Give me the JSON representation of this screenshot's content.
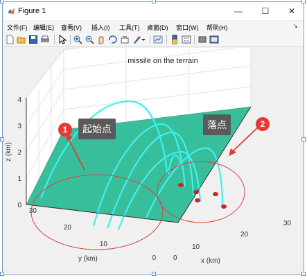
{
  "window": {
    "title": "Figure 1",
    "minimize_glyph": "—",
    "maximize_glyph": "☐",
    "close_glyph": "✕"
  },
  "menu": {
    "items": [
      {
        "label": "文件(F)"
      },
      {
        "label": "编辑(E)"
      },
      {
        "label": "查看(V)"
      },
      {
        "label": "插入(I)"
      },
      {
        "label": "工具(T)"
      },
      {
        "label": "桌面(D)"
      },
      {
        "label": "窗口(W)"
      },
      {
        "label": "帮助(H)"
      }
    ],
    "overflow_glyph": "↘"
  },
  "toolbar": {
    "icons": [
      "new-figure-icon",
      "open-file-icon",
      "save-icon",
      "print-icon",
      "pointer-icon",
      "zoom-in-icon",
      "zoom-out-icon",
      "pan-icon",
      "rotate-3d-icon",
      "data-cursor-icon",
      "brush-icon",
      "link-plot-icon",
      "colorbar-icon",
      "legend-icon",
      "hide-plot-tools-icon",
      "show-plot-tools-icon"
    ]
  },
  "plot": {
    "title": "missile on the terrain",
    "xlabel": "x (km)",
    "ylabel": "y (km)",
    "zlabel": "z (km)",
    "x_ticks": [
      "0",
      "10",
      "20",
      "30"
    ],
    "y_ticks": [
      "0",
      "10",
      "20",
      "30"
    ],
    "z_ticks": [
      "0",
      "1",
      "2",
      "3",
      "4"
    ],
    "terrain_color": "#37bf9b",
    "trajectory_color": "#3ff0f0",
    "impact_color": "#d32020"
  },
  "annotations": {
    "start": {
      "number": "1",
      "label": "起始点"
    },
    "landing": {
      "number": "2",
      "label": "落点"
    },
    "circle_color": "#e04040",
    "arrow_color": "#e53935"
  }
}
